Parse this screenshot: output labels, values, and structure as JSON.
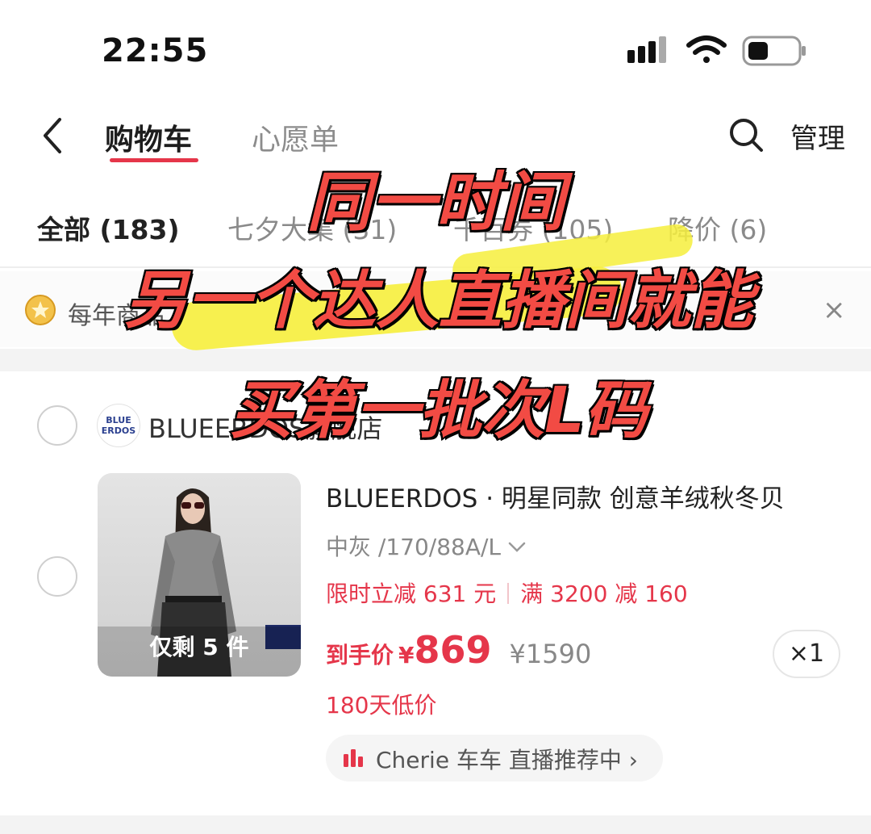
{
  "status_bar": {
    "time": "22:55",
    "icons": [
      "signal-icon",
      "wifi-icon",
      "battery-icon"
    ]
  },
  "header": {
    "back_icon": "chevron-left-icon",
    "tabs": [
      {
        "label": "购物车",
        "active": true
      },
      {
        "label": "心愿单",
        "active": false
      }
    ],
    "search_icon": "search-icon",
    "manage_label": "管理"
  },
  "filters": [
    {
      "label": "全部 (183)",
      "active": true
    },
    {
      "label": "七夕大集 (31)",
      "active": false
    },
    {
      "label": "千百券 (105)",
      "active": false
    },
    {
      "label": "降价 (6)",
      "active": false
    }
  ],
  "banner": {
    "icon": "star-coin-icon",
    "text": "每年商品",
    "close_icon": "close-icon"
  },
  "store": {
    "logo_text": "BLUE ERDOS",
    "name": "BLUEERDOS旗舰店"
  },
  "product": {
    "image": "woman-in-grey-cardigan-photo",
    "stock_label": "仅剩 5 件",
    "title": "BLUEERDOS · 明星同款 创意羊绒秋冬贝",
    "spec": "中灰 /170/88A/L",
    "spec_icon": "chevron-down-icon",
    "promo_1": "限时立减 631 元",
    "promo_2": "满 3200 减 160",
    "price_label": "到手价",
    "currency": "¥",
    "price": "869",
    "original_price": "¥1590",
    "quantity": "×1",
    "low_price_tag": "180天低价",
    "live_icon": "live-bars-icon",
    "live_text": "Cherie 车车  直播推荐中 ›"
  },
  "overlay_caption": {
    "line1": "同一时间",
    "line2": "另一个达人直播间就能",
    "line3": "买第一批次L码",
    "color": "#f24b44",
    "highlight_color": "#f6ee3c"
  },
  "colors": {
    "accent": "#e5364a",
    "muted": "#8a8a8a"
  }
}
